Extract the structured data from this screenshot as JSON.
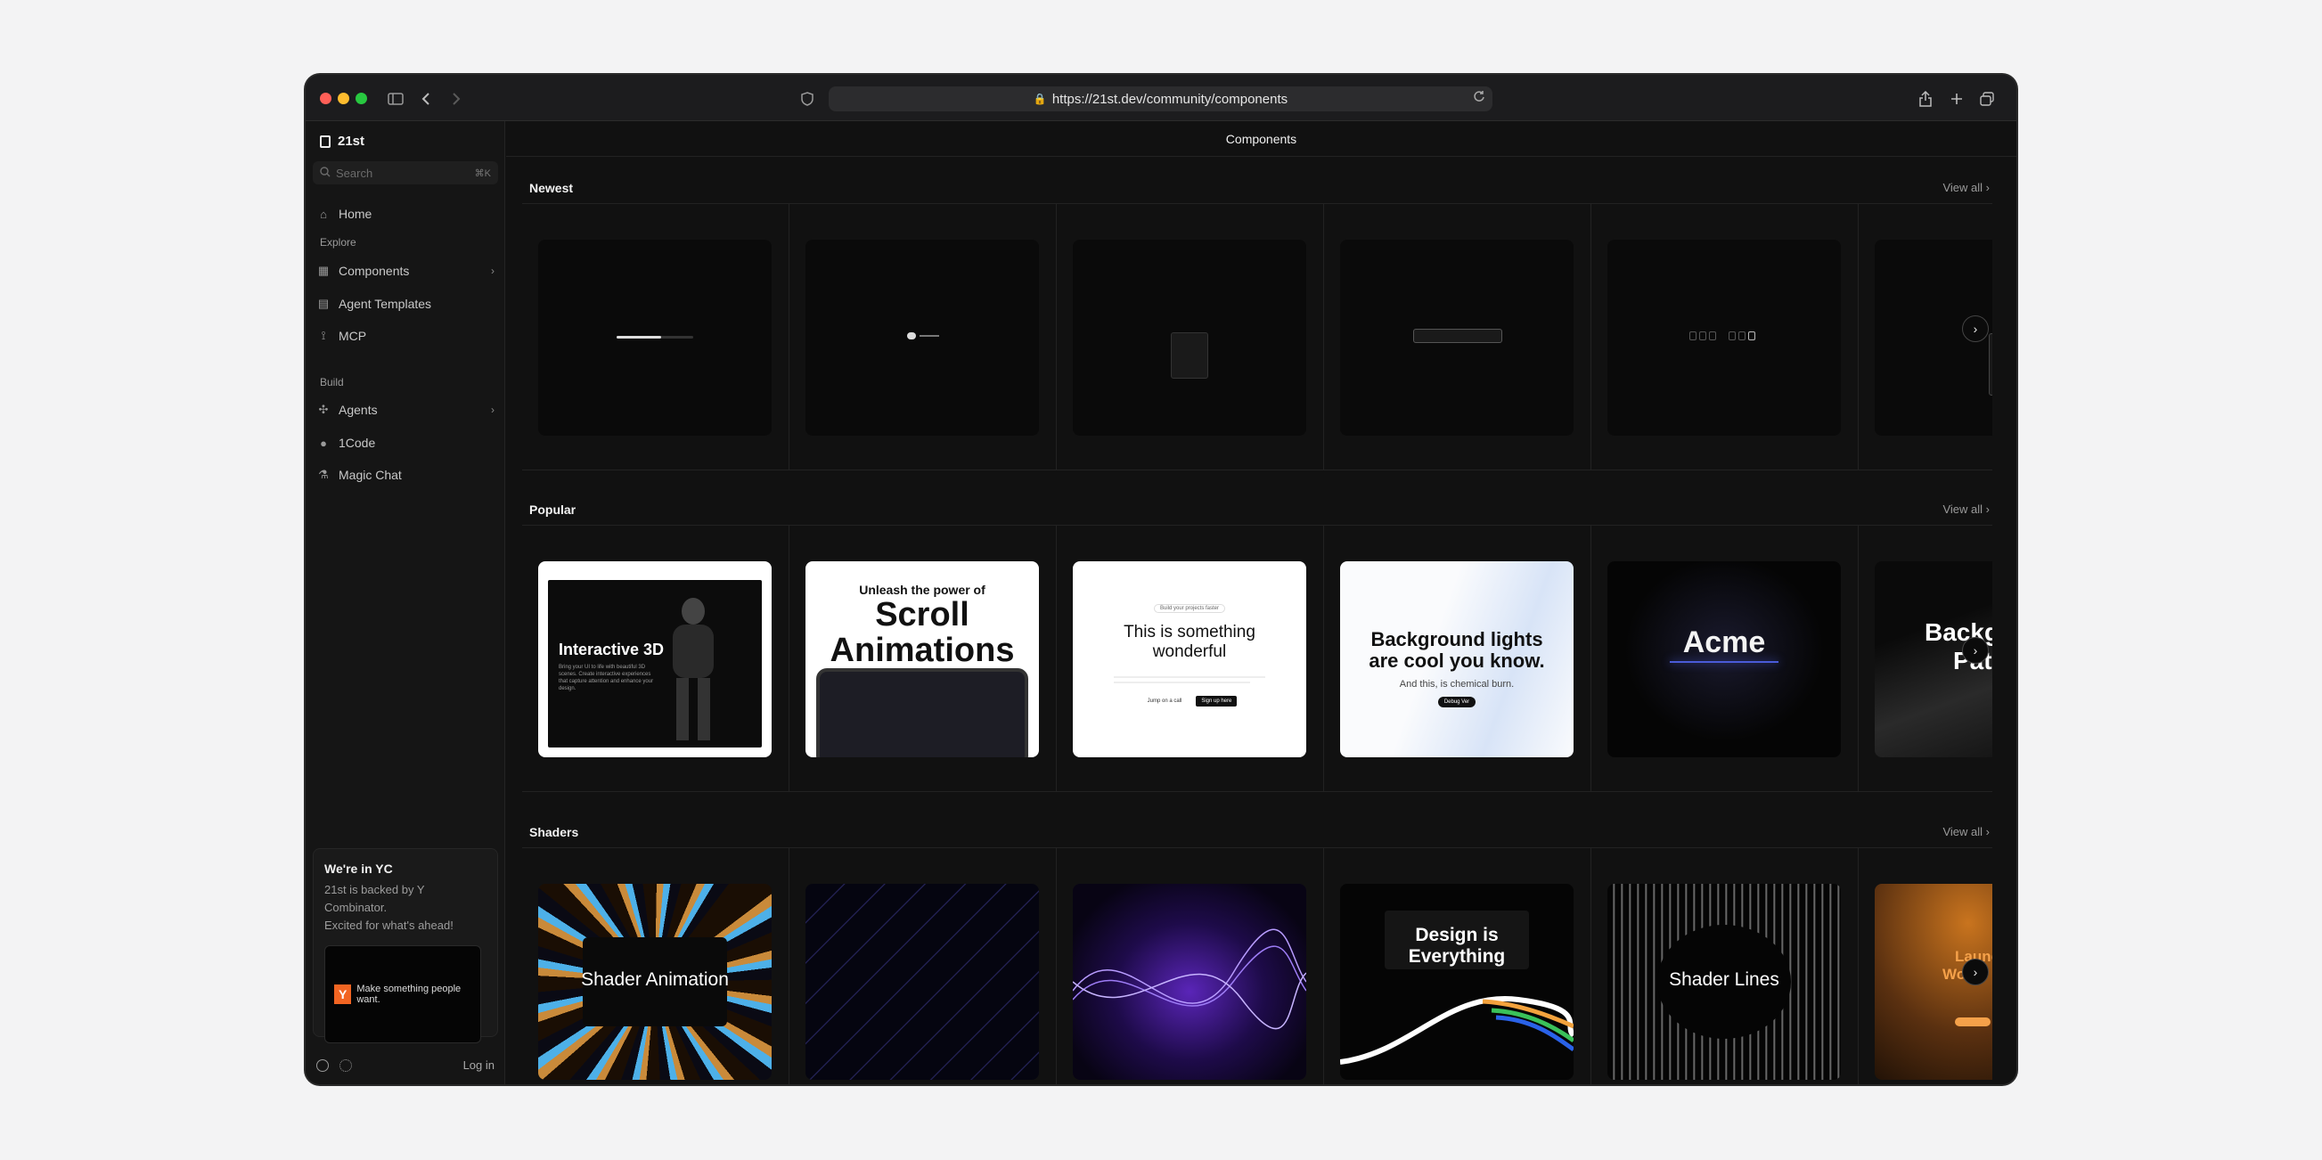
{
  "browser": {
    "url": "https://21st.dev/community/components"
  },
  "sidebar": {
    "brand": "21st",
    "search_placeholder": "Search",
    "search_shortcut": "⌘K",
    "home": "Home",
    "explore_label": "Explore",
    "components": "Components",
    "agent_templates": "Agent Templates",
    "mcp": "MCP",
    "build_label": "Build",
    "agents": "Agents",
    "onecode": "1Code",
    "magic_chat": "Magic Chat",
    "yc": {
      "title": "We're in YC",
      "line1": "21st is backed by Y Combinator.",
      "line2": "Excited for what's ahead!",
      "badge": "Y",
      "tagline": "Make something people want."
    },
    "login": "Log in"
  },
  "main": {
    "header": "Components",
    "view_all": "View all",
    "sections": {
      "newest": "Newest",
      "popular": "Popular",
      "shaders": "Shaders"
    },
    "popular_cards": {
      "interactive3d": "Interactive 3D",
      "interactive3d_desc": "Bring your UI to life with beautiful 3D scenes. Create interactive experiences that capture attention and enhance your design.",
      "scroll_top": "Unleash the power of",
      "scroll_big1": "Scroll",
      "scroll_big2": "Animations",
      "something_pill": "Build your projects faster",
      "something_title1": "This is something",
      "something_title2": "wonderful",
      "something_btn1": "Jump on a call",
      "something_btn2": "Sign up here",
      "bglights_title": "Background lights are cool you know.",
      "bglights_sub": "And this, is chemical burn.",
      "bglights_btn": "Debug Ver",
      "acme": "Acme",
      "bg_partial": "Backgr",
      "bg_partial2": "Pat"
    },
    "shader_cards": {
      "shader_animation": "Shader Animation",
      "design_everything1": "Design is",
      "design_everything2": "Everything",
      "shader_lines": "Shader Lines",
      "lamp1": "Launch",
      "lamp2": "Work"
    }
  },
  "colors": {
    "window_bg": "#111111",
    "sidebar_bg": "#151515",
    "yc_orange": "#f26522"
  }
}
